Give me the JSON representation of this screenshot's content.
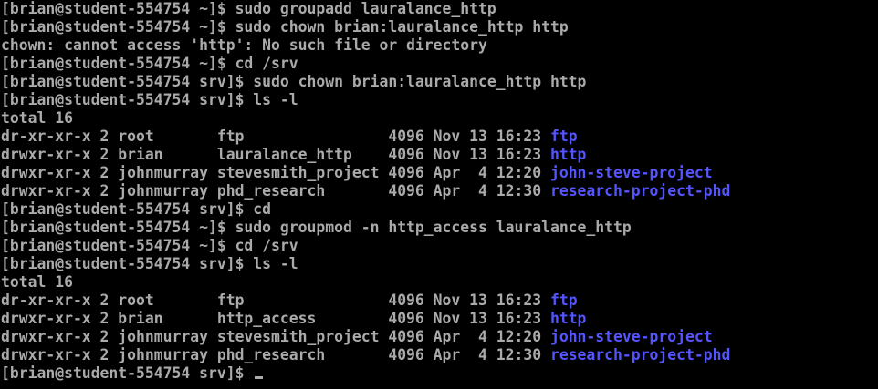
{
  "terminal": {
    "colors": {
      "background": "#000000",
      "text": "#aaaaaa",
      "directory": "#5555ff"
    },
    "lines": [
      {
        "type": "text",
        "text": "[brian@student-554754 ~]$ sudo groupadd lauralance_http"
      },
      {
        "type": "text",
        "text": "[brian@student-554754 ~]$ sudo chown brian:lauralance_http http"
      },
      {
        "type": "text",
        "text": "chown: cannot access 'http': No such file or directory"
      },
      {
        "type": "text",
        "text": "[brian@student-554754 ~]$ cd /srv"
      },
      {
        "type": "text",
        "text": "[brian@student-554754 srv]$ sudo chown brian:lauralance_http http"
      },
      {
        "type": "text",
        "text": "[brian@student-554754 srv]$ ls -l"
      },
      {
        "type": "text",
        "text": "total 16"
      },
      {
        "type": "ls",
        "meta": "dr-xr-xr-x 2 root       ftp                4096 Nov 13 16:23 ",
        "name": "ftp"
      },
      {
        "type": "ls",
        "meta": "drwxr-xr-x 2 brian      lauralance_http    4096 Nov 13 16:23 ",
        "name": "http"
      },
      {
        "type": "ls",
        "meta": "drwxr-xr-x 2 johnmurray stevesmith_project 4096 Apr  4 12:20 ",
        "name": "john-steve-project"
      },
      {
        "type": "ls",
        "meta": "drwxr-xr-x 2 johnmurray phd_research       4096 Apr  4 12:30 ",
        "name": "research-project-phd"
      },
      {
        "type": "text",
        "text": "[brian@student-554754 srv]$ cd"
      },
      {
        "type": "text",
        "text": "[brian@student-554754 ~]$ sudo groupmod -n http_access lauralance_http"
      },
      {
        "type": "text",
        "text": "[brian@student-554754 ~]$ cd /srv"
      },
      {
        "type": "text",
        "text": "[brian@student-554754 srv]$ ls -l"
      },
      {
        "type": "text",
        "text": "total 16"
      },
      {
        "type": "ls",
        "meta": "dr-xr-xr-x 2 root       ftp                4096 Nov 13 16:23 ",
        "name": "ftp"
      },
      {
        "type": "ls",
        "meta": "drwxr-xr-x 2 brian      http_access        4096 Nov 13 16:23 ",
        "name": "http"
      },
      {
        "type": "ls",
        "meta": "drwxr-xr-x 2 johnmurray stevesmith_project 4096 Apr  4 12:20 ",
        "name": "john-steve-project"
      },
      {
        "type": "ls",
        "meta": "drwxr-xr-x 2 johnmurray phd_research       4096 Apr  4 12:30 ",
        "name": "research-project-phd"
      },
      {
        "type": "prompt",
        "text": "[brian@student-554754 srv]$ "
      }
    ]
  }
}
